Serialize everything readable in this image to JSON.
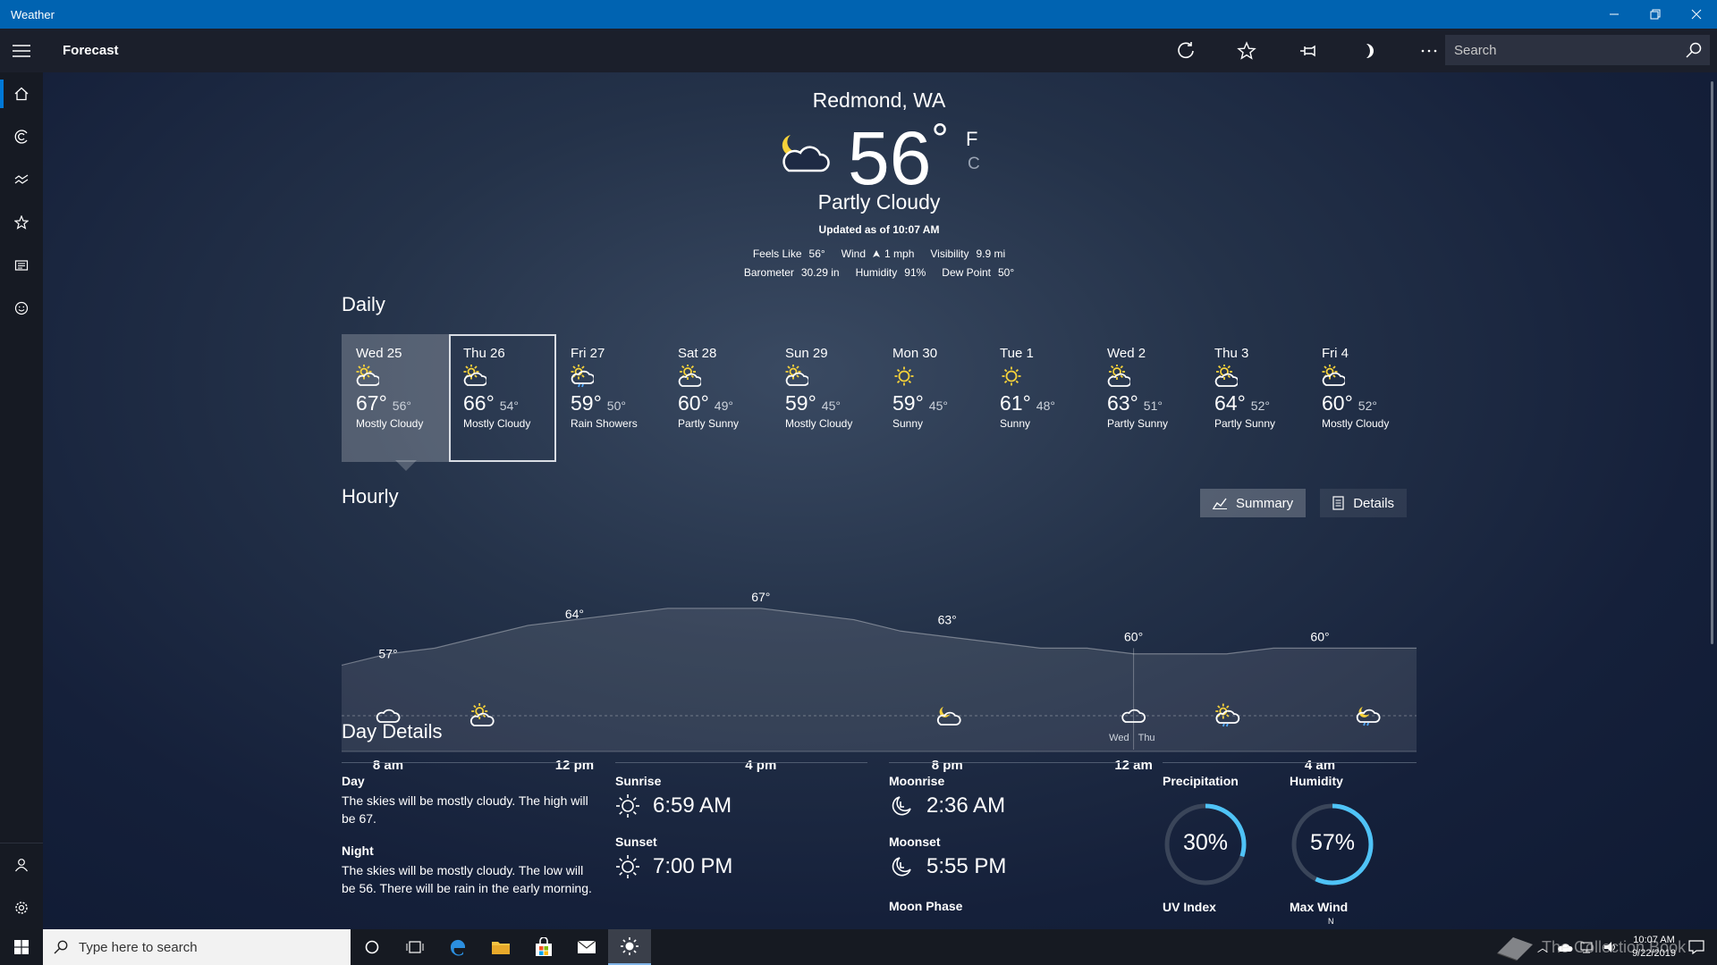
{
  "window": {
    "title": "Weather"
  },
  "header": {
    "page_title": "Forecast",
    "search_placeholder": "Search"
  },
  "current": {
    "location": "Redmond, WA",
    "temp": "56",
    "degree": "°",
    "unit_f": "F",
    "unit_c": "C",
    "condition": "Partly Cloudy",
    "updated": "Updated as of 10:07 AM",
    "stats_row1": [
      {
        "label": "Feels Like",
        "value": "56°"
      },
      {
        "label": "Wind",
        "value": "1 mph"
      },
      {
        "label": "Visibility",
        "value": "9.9 mi"
      }
    ],
    "stats_row2": [
      {
        "label": "Barometer",
        "value": "30.29 in"
      },
      {
        "label": "Humidity",
        "value": "91%"
      },
      {
        "label": "Dew Point",
        "value": "50°"
      }
    ]
  },
  "daily": {
    "title": "Daily",
    "days": [
      {
        "name": "Wed 25",
        "hi": "67°",
        "lo": "56°",
        "cond": "Mostly Cloudy",
        "icon": "mostly-cloudy"
      },
      {
        "name": "Thu 26",
        "hi": "66°",
        "lo": "54°",
        "cond": "Mostly Cloudy",
        "icon": "mostly-cloudy"
      },
      {
        "name": "Fri 27",
        "hi": "59°",
        "lo": "50°",
        "cond": "Rain Showers",
        "icon": "rain-showers"
      },
      {
        "name": "Sat 28",
        "hi": "60°",
        "lo": "49°",
        "cond": "Partly Sunny",
        "icon": "partly-sunny"
      },
      {
        "name": "Sun 29",
        "hi": "59°",
        "lo": "45°",
        "cond": "Mostly Cloudy",
        "icon": "mostly-cloudy"
      },
      {
        "name": "Mon 30",
        "hi": "59°",
        "lo": "45°",
        "cond": "Sunny",
        "icon": "sunny"
      },
      {
        "name": "Tue 1",
        "hi": "61°",
        "lo": "48°",
        "cond": "Sunny",
        "icon": "sunny"
      },
      {
        "name": "Wed 2",
        "hi": "63°",
        "lo": "51°",
        "cond": "Partly Sunny",
        "icon": "partly-sunny"
      },
      {
        "name": "Thu 3",
        "hi": "64°",
        "lo": "52°",
        "cond": "Partly Sunny",
        "icon": "partly-sunny"
      },
      {
        "name": "Fri 4",
        "hi": "60°",
        "lo": "52°",
        "cond": "Mostly Cloudy",
        "icon": "mostly-cloudy"
      }
    ]
  },
  "hourly": {
    "title": "Hourly",
    "summary_label": "Summary",
    "details_label": "Details",
    "time_labels": [
      "8 am",
      "12 pm",
      "4 pm",
      "8 pm",
      "12 am",
      "4 am"
    ],
    "day_split": [
      "Wed",
      "Thu"
    ],
    "temp_labels": [
      "57°",
      "64°",
      "67°",
      "63°",
      "60°",
      "60°"
    ]
  },
  "chart_data": {
    "type": "area",
    "title": "",
    "xlabel": "",
    "ylabel": "",
    "x": [
      "8 am",
      "9 am",
      "10 am",
      "11 am",
      "12 pm",
      "1 pm",
      "2 pm",
      "3 pm",
      "4 pm",
      "5 pm",
      "6 pm",
      "7 pm",
      "8 pm",
      "9 pm",
      "10 pm",
      "11 pm",
      "12 am",
      "1 am",
      "2 am",
      "3 am",
      "4 am",
      "5 am"
    ],
    "series": [
      {
        "values": [
          57,
          59,
          60,
          62,
          64,
          65,
          66,
          67,
          67,
          67,
          66,
          65,
          63,
          62,
          61,
          60,
          60,
          59,
          59,
          59,
          60,
          60
        ]
      }
    ],
    "icons": [
      {
        "x": "8 am",
        "icon": "cloudy"
      },
      {
        "x": "10 am",
        "icon": "partly-sunny"
      },
      {
        "x": "8 pm",
        "icon": "partly-cloudy-night"
      },
      {
        "x": "12 am",
        "icon": "cloudy"
      },
      {
        "x": "2 am",
        "icon": "rain-showers"
      },
      {
        "x": "5 am",
        "icon": "rain-showers-night"
      }
    ]
  },
  "day_details": {
    "title": "Day Details",
    "day_label": "Day",
    "day_text": "The skies will be mostly cloudy. The high will be 67.",
    "night_label": "Night",
    "night_text": "The skies will be mostly cloudy. The low will be 56. There will be rain in the early morning.",
    "sunrise_label": "Sunrise",
    "sunrise": "6:59 AM",
    "sunset_label": "Sunset",
    "sunset": "7:00 PM",
    "moonrise_label": "Moonrise",
    "moonrise": "2:36 AM",
    "moonset_label": "Moonset",
    "moonset": "5:55 PM",
    "moon_phase_label": "Moon Phase",
    "precip_label": "Precipitation",
    "precip": "30%",
    "precip_fraction": 0.3,
    "humidity_label": "Humidity",
    "humidity": "57%",
    "humidity_fraction": 0.57,
    "uv_label": "UV Index",
    "max_wind_label": "Max Wind",
    "wind_dir": "N"
  },
  "taskbar": {
    "search_placeholder": "Type here to search",
    "time": "10:07 AM",
    "date": "9/22/2019"
  },
  "watermark": "The Collection Book",
  "colors": {
    "accent": "#0078d7",
    "ring": "#4fc3f7",
    "titlebar": "#0063b1"
  }
}
